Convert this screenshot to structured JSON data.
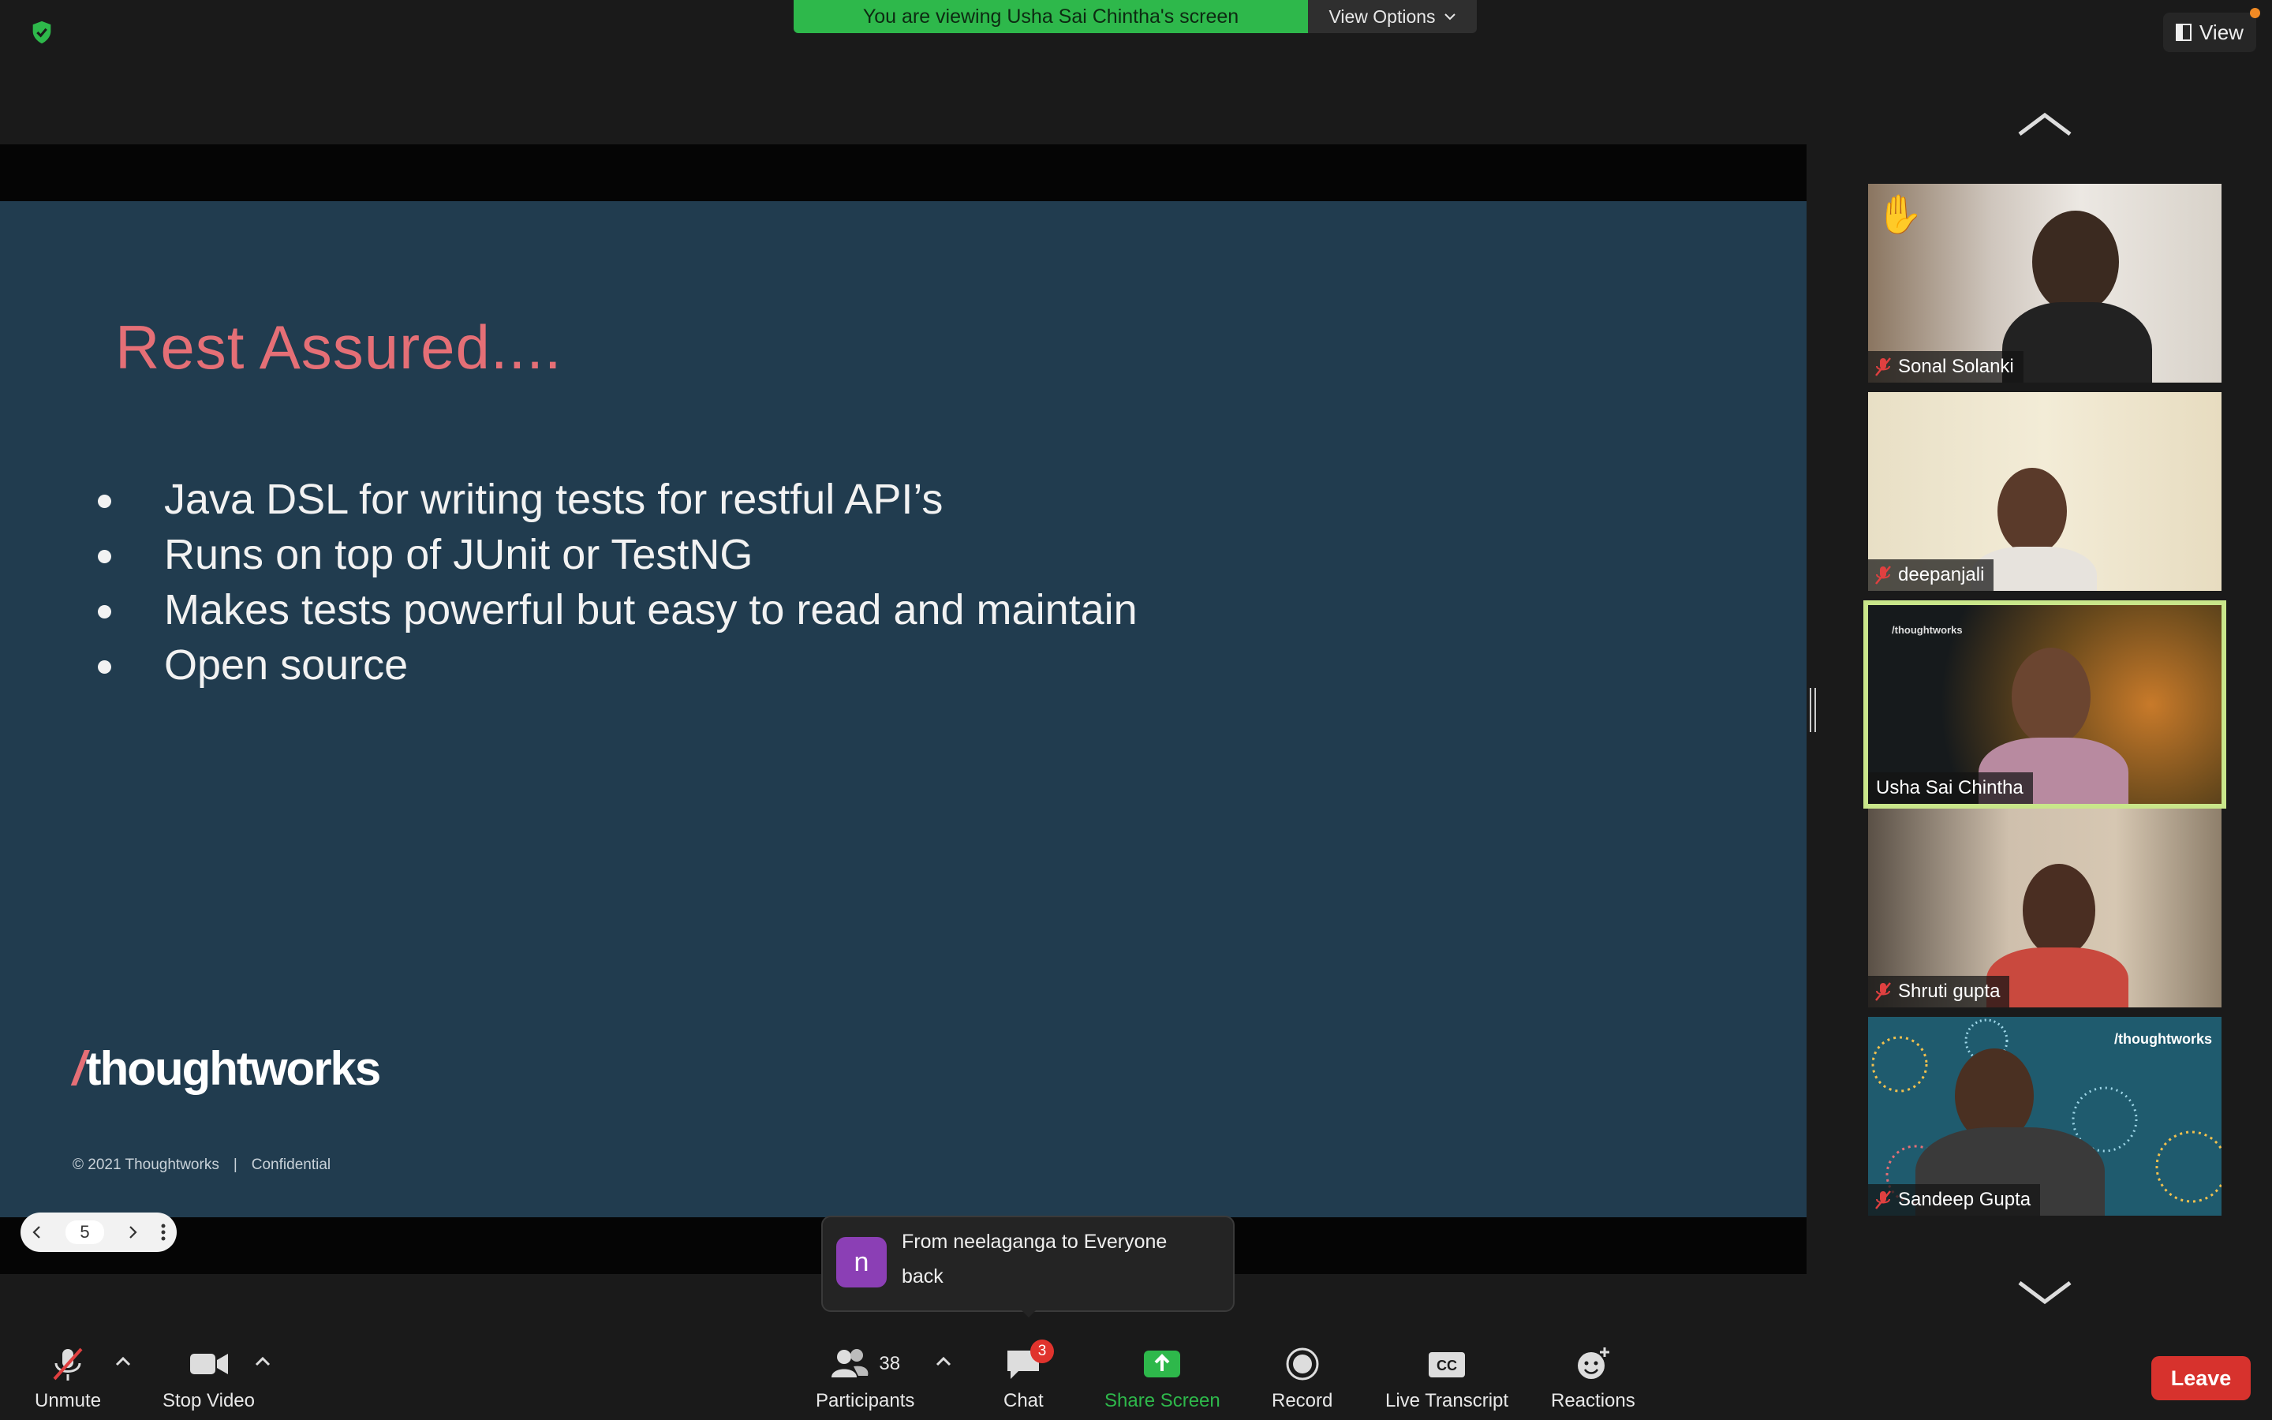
{
  "topbar": {
    "banner_text": "You are viewing Usha Sai Chintha's screen",
    "view_options_label": "View Options",
    "view_button_label": "View"
  },
  "slide": {
    "title": "Rest Assured....",
    "bullets": [
      "Java DSL for writing tests for restful API’s",
      "Runs on top of JUnit or TestNG",
      "Makes tests powerful but easy to read and maintain",
      "Open source"
    ],
    "logo_text": "thoughtworks",
    "copyright": "© 2021 Thoughtworks",
    "confidential": "Confidential",
    "page_number": "5"
  },
  "participants": [
    {
      "name": "Sonal Solanki",
      "muted": true,
      "hand_raised": true
    },
    {
      "name": "deepanjali",
      "muted": true
    },
    {
      "name": "Usha Sai Chintha",
      "muted": false,
      "active_speaker": true
    },
    {
      "name": "Shruti gupta",
      "muted": true
    },
    {
      "name": "Sandeep Gupta",
      "muted": true
    }
  ],
  "toolbar": {
    "unmute_label": "Unmute",
    "stop_video_label": "Stop Video",
    "participants_label": "Participants",
    "participants_count": "38",
    "chat_label": "Chat",
    "chat_badge": "3",
    "share_screen_label": "Share Screen",
    "record_label": "Record",
    "live_transcript_label": "Live Transcript",
    "reactions_label": "Reactions",
    "leave_label": "Leave"
  },
  "chat_notification": {
    "avatar_letter": "n",
    "from": "From neelaganga to Everyone",
    "message": "back"
  },
  "colors": {
    "banner_green": "#2eb84b",
    "slide_bg": "#213c4f",
    "slide_title": "#e56f76",
    "leave_red": "#d7322d",
    "active_speaker_border": "#c9e68a"
  }
}
